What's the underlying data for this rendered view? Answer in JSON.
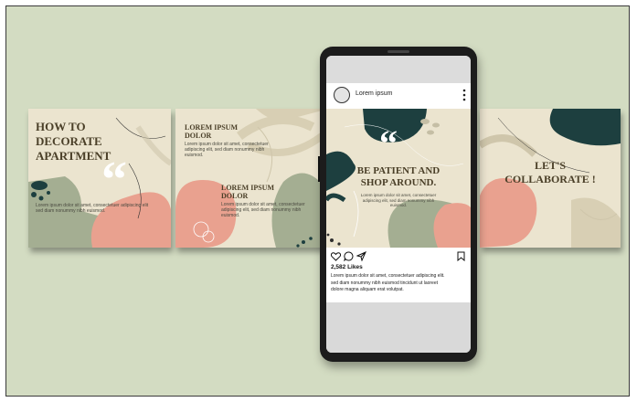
{
  "panel1": {
    "title_line1": "HOW TO",
    "title_line2": "DECORATE",
    "title_line3": "APARTMENT",
    "quote_mark": "“",
    "body_line1": "Lorem ipsum dolor sit amet, consectetuer adipiscing elit",
    "body_line2": "sed diam nonummy nibh euismod."
  },
  "panel2": {
    "heading1_line1": "LOREM IPSUM",
    "heading1_line2": "DOLOR",
    "body1_line1": "Lorem ipsum dolor sit amet, consectetuer",
    "body1_line2": "adipiscing elit, sed diam nonummy nibh",
    "body1_line3": "euismod.",
    "heading2_line1": "LOREM IPSUM",
    "heading2_line2": "DOLOR",
    "body2_line1": "Lorem ipsum dolor sit amet, consectetuer",
    "body2_line2": "adipiscing elit, sed diam nonummy nibh",
    "body2_line3": "euismod."
  },
  "panel3": {
    "title_line1": "LET'S",
    "title_line2": "COLLABORATE !"
  },
  "phone": {
    "username": "Lorem ipsum",
    "post": {
      "quote_mark": "“",
      "title_line1": "BE PATIENT AND",
      "title_line2": "SHOP AROUND.",
      "body_line1": "Lorem ipsum dolor sit amet, consectetuer",
      "body_line2": "adipiscing elit, sed diam nonummy nibh",
      "body_line3": "euismod."
    },
    "likes": "2,582 Likes",
    "caption_line1": "Lorem ipsum dolor sit amet, consectetuer adipiscing elit.",
    "caption_line2": "sed diam nonummy nibh euismod tincidunt ut laoreet",
    "caption_line3": "dolore magna aliquam erat volutpat."
  },
  "colors": {
    "background": "#d3dcc2",
    "cream": "#ebe4cf",
    "pink": "#e9a18f",
    "sage": "#a4ae92",
    "dark_teal": "#1d3f3f",
    "brown_text": "#4a3f28"
  },
  "icons": {
    "avatar": "circle",
    "more": "vertical-dots",
    "like": "heart",
    "comment": "speech-bubble",
    "share": "paper-plane",
    "save": "bookmark"
  }
}
